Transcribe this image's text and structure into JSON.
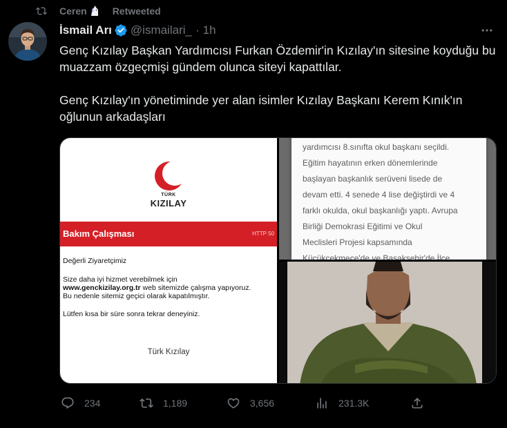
{
  "retweet": {
    "user": "Ceren",
    "label": "Retweeted",
    "icon": "retweet-icon"
  },
  "author": {
    "display_name": "İsmail Arı",
    "handle": "@ismailari_",
    "separator": "·",
    "time": "1h",
    "verified_color": "#1d9bf0"
  },
  "tweet": {
    "paragraphs": [
      "Genç Kızılay Başkan Yardımcısı Furkan Özdemir'in Kızılay'ın sitesine koyduğu bu muazzam özgeçmişi gündem olunca siteyi kapattılar.",
      "Genç Kızılay'ın yönetiminde yer alan isimler Kızılay Başkanı Kerem Kınık'ın oğlunun arkadaşları"
    ]
  },
  "media": {
    "maintenance": {
      "logo_small": "TÜRK",
      "logo_name": "KIZILAY",
      "title": "Bakım Çalışması",
      "code": "HTTP 50",
      "greeting": "Değerli Ziyaretçimiz",
      "line1": "Size daha iyi hizmet verebilmek için",
      "site": "www.genckizilay.org.tr",
      "line2_rest": " web sitemizde çalışma yapıyoruz.",
      "line3": "Bu nedenle sitemiz geçici olarak kapatılmıştır.",
      "line4": "Lütfen kısa bir süre sonra tekrar deneyiniz.",
      "footer": "Türk Kızılay",
      "accent": "#d41f26"
    },
    "document_lines": [
      "yardımcısı 8.sınıfta okul başkanı seçildi.",
      "Eğitim hayatının erken dönemlerinde",
      "başlayan başkanlık serüveni lisede de",
      "devam etti. 4 senede 4 lise değiştirdi ve 4",
      "farklı okulda, okul başkanlığı yaptı. Avrupa",
      "Birliği Demokrasi Eğitimi ve Okul",
      "Meclisleri Projesi kapsamında",
      "Küçükçekmece'de ve Başakşehir'de İlçe"
    ]
  },
  "actions": {
    "replies": "234",
    "retweets": "1,189",
    "likes": "3,656",
    "views": "231.3K"
  }
}
